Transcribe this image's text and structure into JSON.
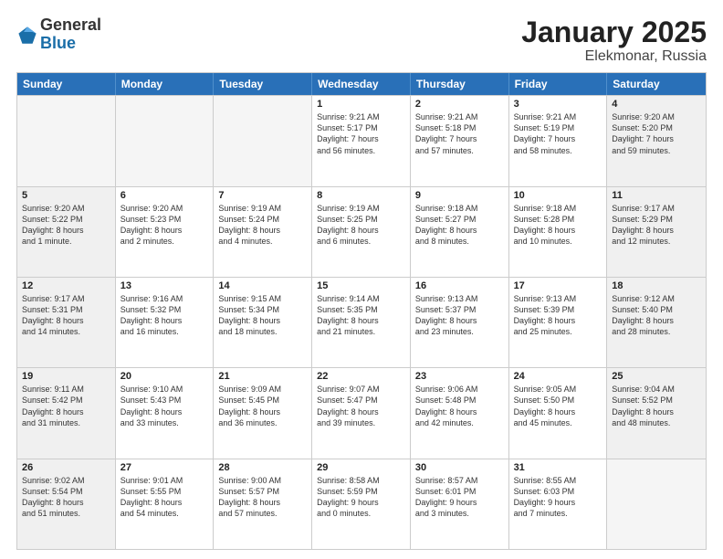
{
  "header": {
    "logo": {
      "general": "General",
      "blue": "Blue"
    },
    "title": "January 2025",
    "subtitle": "Elekmonar, Russia"
  },
  "weekdays": [
    "Sunday",
    "Monday",
    "Tuesday",
    "Wednesday",
    "Thursday",
    "Friday",
    "Saturday"
  ],
  "rows": [
    [
      {
        "day": "",
        "info": "",
        "empty": true
      },
      {
        "day": "",
        "info": "",
        "empty": true
      },
      {
        "day": "",
        "info": "",
        "empty": true
      },
      {
        "day": "1",
        "info": "Sunrise: 9:21 AM\nSunset: 5:17 PM\nDaylight: 7 hours\nand 56 minutes.",
        "empty": false
      },
      {
        "day": "2",
        "info": "Sunrise: 9:21 AM\nSunset: 5:18 PM\nDaylight: 7 hours\nand 57 minutes.",
        "empty": false
      },
      {
        "day": "3",
        "info": "Sunrise: 9:21 AM\nSunset: 5:19 PM\nDaylight: 7 hours\nand 58 minutes.",
        "empty": false
      },
      {
        "day": "4",
        "info": "Sunrise: 9:20 AM\nSunset: 5:20 PM\nDaylight: 7 hours\nand 59 minutes.",
        "empty": false,
        "shaded": true
      }
    ],
    [
      {
        "day": "5",
        "info": "Sunrise: 9:20 AM\nSunset: 5:22 PM\nDaylight: 8 hours\nand 1 minute.",
        "empty": false,
        "shaded": true
      },
      {
        "day": "6",
        "info": "Sunrise: 9:20 AM\nSunset: 5:23 PM\nDaylight: 8 hours\nand 2 minutes.",
        "empty": false
      },
      {
        "day": "7",
        "info": "Sunrise: 9:19 AM\nSunset: 5:24 PM\nDaylight: 8 hours\nand 4 minutes.",
        "empty": false
      },
      {
        "day": "8",
        "info": "Sunrise: 9:19 AM\nSunset: 5:25 PM\nDaylight: 8 hours\nand 6 minutes.",
        "empty": false
      },
      {
        "day": "9",
        "info": "Sunrise: 9:18 AM\nSunset: 5:27 PM\nDaylight: 8 hours\nand 8 minutes.",
        "empty": false
      },
      {
        "day": "10",
        "info": "Sunrise: 9:18 AM\nSunset: 5:28 PM\nDaylight: 8 hours\nand 10 minutes.",
        "empty": false
      },
      {
        "day": "11",
        "info": "Sunrise: 9:17 AM\nSunset: 5:29 PM\nDaylight: 8 hours\nand 12 minutes.",
        "empty": false,
        "shaded": true
      }
    ],
    [
      {
        "day": "12",
        "info": "Sunrise: 9:17 AM\nSunset: 5:31 PM\nDaylight: 8 hours\nand 14 minutes.",
        "empty": false,
        "shaded": true
      },
      {
        "day": "13",
        "info": "Sunrise: 9:16 AM\nSunset: 5:32 PM\nDaylight: 8 hours\nand 16 minutes.",
        "empty": false
      },
      {
        "day": "14",
        "info": "Sunrise: 9:15 AM\nSunset: 5:34 PM\nDaylight: 8 hours\nand 18 minutes.",
        "empty": false
      },
      {
        "day": "15",
        "info": "Sunrise: 9:14 AM\nSunset: 5:35 PM\nDaylight: 8 hours\nand 21 minutes.",
        "empty": false
      },
      {
        "day": "16",
        "info": "Sunrise: 9:13 AM\nSunset: 5:37 PM\nDaylight: 8 hours\nand 23 minutes.",
        "empty": false
      },
      {
        "day": "17",
        "info": "Sunrise: 9:13 AM\nSunset: 5:39 PM\nDaylight: 8 hours\nand 25 minutes.",
        "empty": false
      },
      {
        "day": "18",
        "info": "Sunrise: 9:12 AM\nSunset: 5:40 PM\nDaylight: 8 hours\nand 28 minutes.",
        "empty": false,
        "shaded": true
      }
    ],
    [
      {
        "day": "19",
        "info": "Sunrise: 9:11 AM\nSunset: 5:42 PM\nDaylight: 8 hours\nand 31 minutes.",
        "empty": false,
        "shaded": true
      },
      {
        "day": "20",
        "info": "Sunrise: 9:10 AM\nSunset: 5:43 PM\nDaylight: 8 hours\nand 33 minutes.",
        "empty": false
      },
      {
        "day": "21",
        "info": "Sunrise: 9:09 AM\nSunset: 5:45 PM\nDaylight: 8 hours\nand 36 minutes.",
        "empty": false
      },
      {
        "day": "22",
        "info": "Sunrise: 9:07 AM\nSunset: 5:47 PM\nDaylight: 8 hours\nand 39 minutes.",
        "empty": false
      },
      {
        "day": "23",
        "info": "Sunrise: 9:06 AM\nSunset: 5:48 PM\nDaylight: 8 hours\nand 42 minutes.",
        "empty": false
      },
      {
        "day": "24",
        "info": "Sunrise: 9:05 AM\nSunset: 5:50 PM\nDaylight: 8 hours\nand 45 minutes.",
        "empty": false
      },
      {
        "day": "25",
        "info": "Sunrise: 9:04 AM\nSunset: 5:52 PM\nDaylight: 8 hours\nand 48 minutes.",
        "empty": false,
        "shaded": true
      }
    ],
    [
      {
        "day": "26",
        "info": "Sunrise: 9:02 AM\nSunset: 5:54 PM\nDaylight: 8 hours\nand 51 minutes.",
        "empty": false,
        "shaded": true
      },
      {
        "day": "27",
        "info": "Sunrise: 9:01 AM\nSunset: 5:55 PM\nDaylight: 8 hours\nand 54 minutes.",
        "empty": false
      },
      {
        "day": "28",
        "info": "Sunrise: 9:00 AM\nSunset: 5:57 PM\nDaylight: 8 hours\nand 57 minutes.",
        "empty": false
      },
      {
        "day": "29",
        "info": "Sunrise: 8:58 AM\nSunset: 5:59 PM\nDaylight: 9 hours\nand 0 minutes.",
        "empty": false
      },
      {
        "day": "30",
        "info": "Sunrise: 8:57 AM\nSunset: 6:01 PM\nDaylight: 9 hours\nand 3 minutes.",
        "empty": false
      },
      {
        "day": "31",
        "info": "Sunrise: 8:55 AM\nSunset: 6:03 PM\nDaylight: 9 hours\nand 7 minutes.",
        "empty": false
      },
      {
        "day": "",
        "info": "",
        "empty": true,
        "shaded": true
      }
    ]
  ]
}
